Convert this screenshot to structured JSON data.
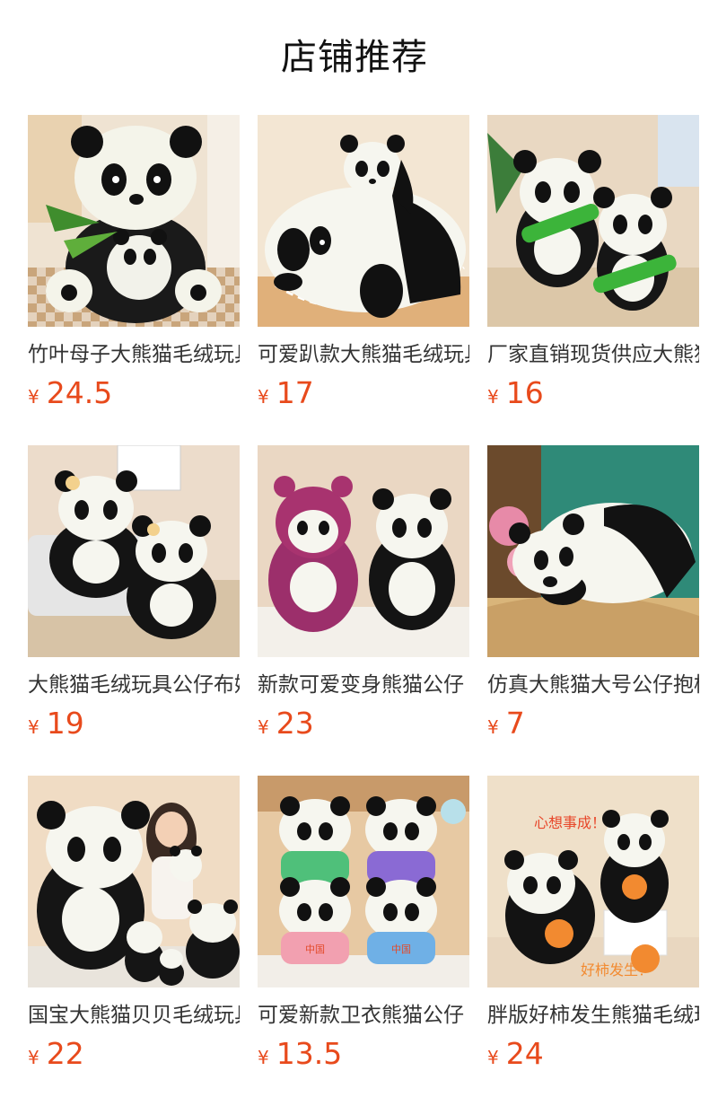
{
  "header": {
    "title": "店铺推荐"
  },
  "products": [
    {
      "name": "竹叶母子大熊猫毛绒玩具",
      "currency": "¥",
      "price": "24.5",
      "image": "panda-mother-baby-bamboo-leaves-plush"
    },
    {
      "name": "可爱趴款大熊猫毛绒玩具",
      "currency": "¥",
      "price": "17",
      "image": "lying-panda-with-cub-on-back-plush"
    },
    {
      "name": "厂家直销现货供应大熊猫",
      "currency": "¥",
      "price": "16",
      "image": "two-pandas-holding-bamboo-plush"
    },
    {
      "name": "大熊猫毛绒玩具公仔布娃娃",
      "currency": "¥",
      "price": "19",
      "image": "two-pandas-with-flower-plush"
    },
    {
      "name": "新款可爱变身熊猫公仔",
      "currency": "¥",
      "price": "23",
      "image": "purple-costume-panda-and-panda-plush"
    },
    {
      "name": "仿真大熊猫大号公仔抱枕",
      "currency": "¥",
      "price": "7",
      "image": "lying-realistic-panda-on-straw-plush"
    },
    {
      "name": "国宝大熊猫贝贝毛绒玩具",
      "currency": "¥",
      "price": "22",
      "image": "panda-family-sizes-with-model-plush"
    },
    {
      "name": "可爱新款卫衣熊猫公仔",
      "currency": "¥",
      "price": "13.5",
      "image": "four-pandas-in-hoodies-plush"
    },
    {
      "name": "胖版好柿发生熊猫毛绒玩具",
      "currency": "¥",
      "price": "24",
      "image": "pandas-holding-persimmon-plush"
    }
  ],
  "image_texts": {
    "hoodie": "中国",
    "promo_top": "心想事成！",
    "promo_bottom": "好柿发生！"
  },
  "colors": {
    "price": "#e84a1c",
    "title": "#111111",
    "name": "#333333"
  }
}
